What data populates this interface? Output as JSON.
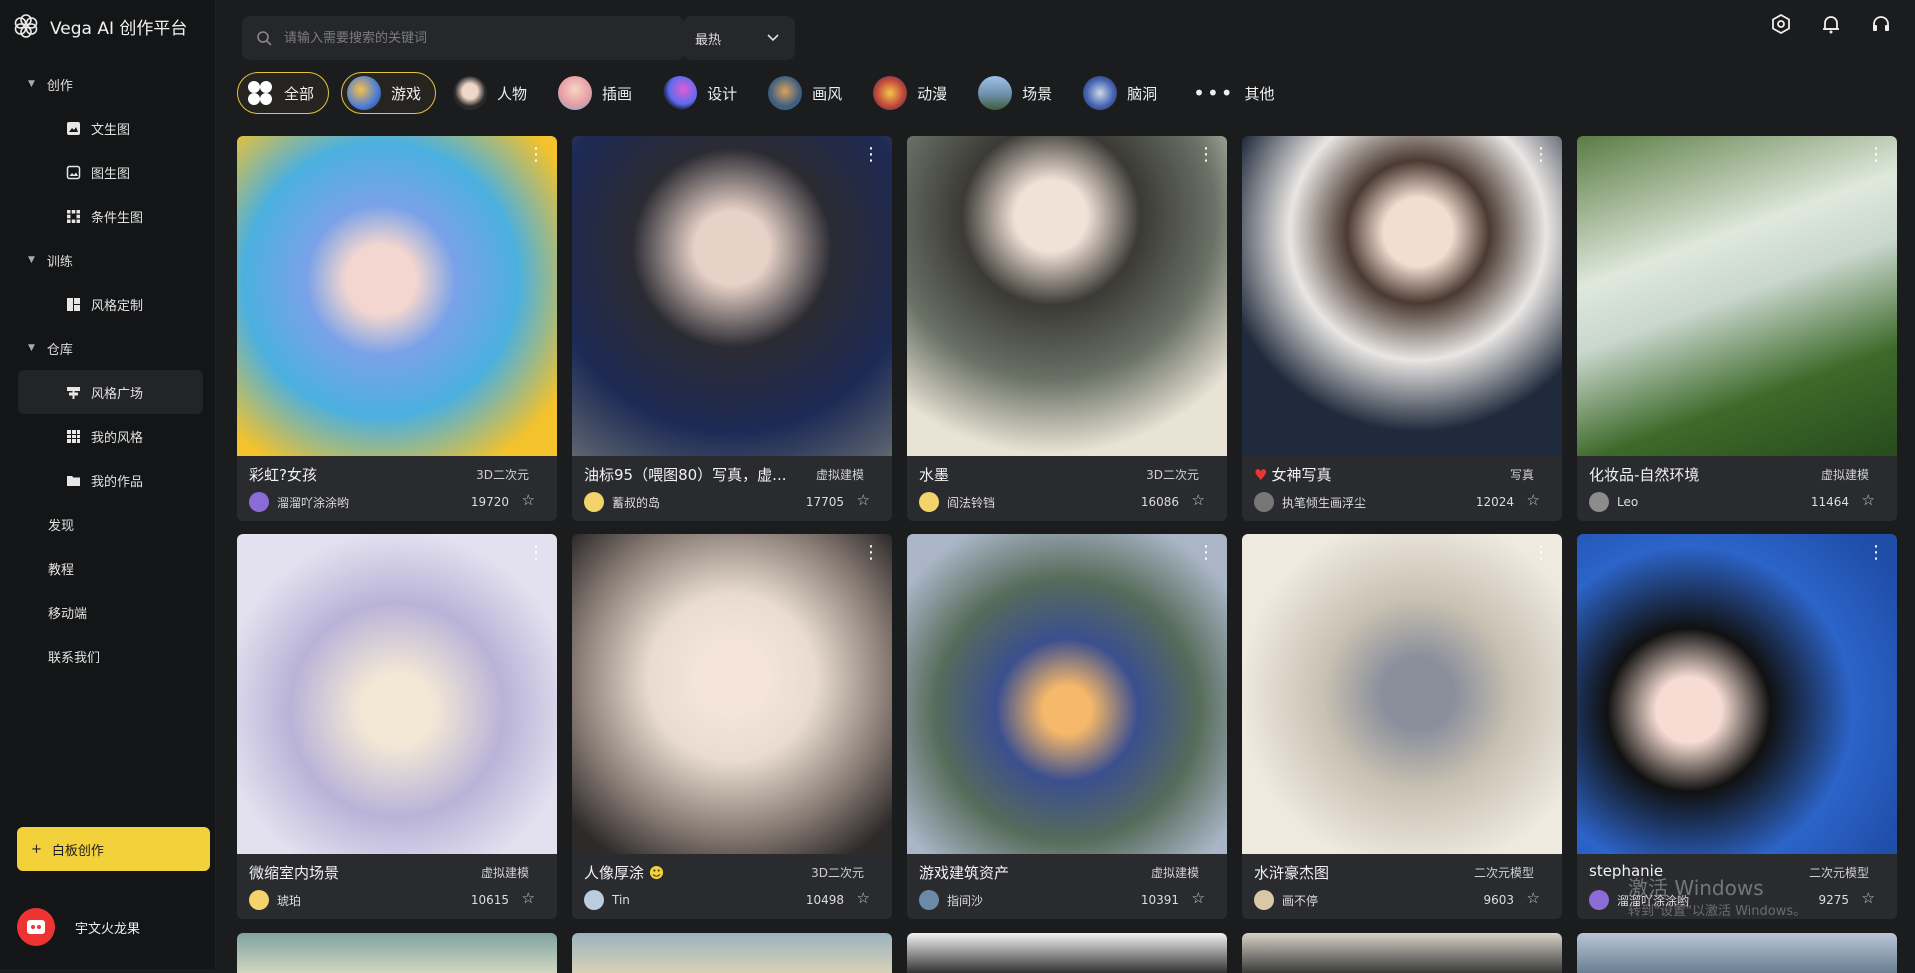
{
  "app": {
    "title": "Vega AI 创作平台"
  },
  "sidebar": {
    "groups": [
      {
        "label": "创作",
        "items": [
          "文生图",
          "图生图",
          "条件生图"
        ]
      },
      {
        "label": "训练",
        "items": [
          "风格定制"
        ]
      },
      {
        "label": "仓库",
        "items": [
          "风格广场",
          "我的风格",
          "我的作品"
        ]
      }
    ],
    "links": [
      "发现",
      "教程",
      "移动端",
      "联系我们"
    ],
    "whiteboard_button": "白板创作",
    "user_name": "宇文火龙果"
  },
  "search": {
    "placeholder": "请输入需要搜索的关键词"
  },
  "sort": {
    "value": "最热"
  },
  "categories": [
    "全部",
    "游戏",
    "人物",
    "插画",
    "设计",
    "画风",
    "动漫",
    "场景",
    "脑洞",
    "其他"
  ],
  "cards": [
    {
      "title": "彩虹?女孩",
      "tag": "3D二次元",
      "author": "溜溜吖涂涂哟",
      "count": "19720"
    },
    {
      "title": "油标95（喂图80）写真，虚...",
      "tag": "虚拟建模",
      "author": "蓄叔的岛",
      "count": "17705"
    },
    {
      "title": "水墨",
      "tag": "3D二次元",
      "author": "阎法铃铛",
      "count": "16086"
    },
    {
      "title": "女神写真",
      "tag": "写真",
      "author": "执笔倾生画浮尘",
      "count": "12024"
    },
    {
      "title": "化妆品-自然环境",
      "tag": "虚拟建模",
      "author": "Leo",
      "count": "11464"
    },
    {
      "title": "微缩室内场景",
      "tag": "虚拟建模",
      "author": "琥珀",
      "count": "10615"
    },
    {
      "title": "人像厚涂",
      "tag": "3D二次元",
      "author": "Tin",
      "count": "10498"
    },
    {
      "title": "游戏建筑资产",
      "tag": "虚拟建模",
      "author": "指间沙",
      "count": "10391"
    },
    {
      "title": "水浒豪杰图",
      "tag": "二次元模型",
      "author": "画不停",
      "count": "9603"
    },
    {
      "title": "stephanie",
      "tag": "二次元模型",
      "author": "溜溜吖涂涂哟",
      "count": "9275"
    }
  ],
  "watermark": {
    "line1": "激活 Windows",
    "line2": "转到\"设置\"以激活 Windows。"
  },
  "colors": {
    "accent": "#f3d13b",
    "background": "#1b1c1e",
    "sidebar": "#141516"
  }
}
